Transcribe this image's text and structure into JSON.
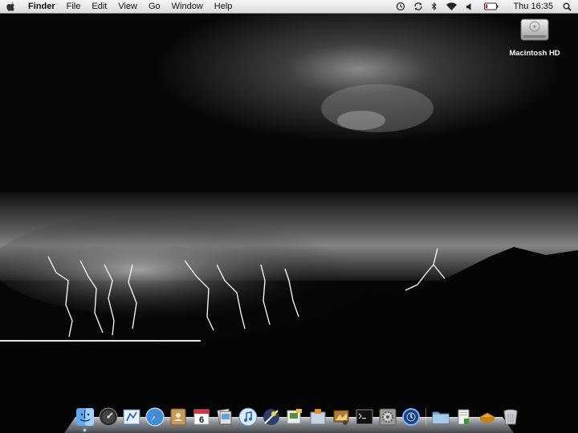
{
  "menubar": {
    "apple_icon": "apple-logo-icon",
    "app_name": "Finder",
    "menus": [
      "File",
      "Edit",
      "View",
      "Go",
      "Window",
      "Help"
    ],
    "status": {
      "icons": [
        "time-machine-icon",
        "sync-icon",
        "bluetooth-icon",
        "wifi-icon",
        "volume-icon",
        "battery-icon"
      ],
      "clock": "Thu 16:35",
      "search_icon": "spotlight-icon"
    }
  },
  "desktop": {
    "icons": [
      {
        "label": "Macintosh HD",
        "icon": "hard-drive-icon"
      }
    ]
  },
  "dock": {
    "apps": [
      {
        "icon": "finder-icon",
        "running": true
      },
      {
        "icon": "dashboard-icon",
        "running": false
      },
      {
        "icon": "mail-icon",
        "running": false
      },
      {
        "icon": "safari-icon",
        "running": false
      },
      {
        "icon": "address-book-icon",
        "running": false
      },
      {
        "icon": "ical-icon",
        "running": false,
        "badge": "6"
      },
      {
        "icon": "preview-icon",
        "running": false
      },
      {
        "icon": "itunes-icon",
        "running": false
      },
      {
        "icon": "iphoto-icon",
        "running": false
      },
      {
        "icon": "imovie-icon",
        "running": false
      },
      {
        "icon": "iweb-icon",
        "running": false
      },
      {
        "icon": "image-capture-icon",
        "running": false
      },
      {
        "icon": "terminal-icon",
        "running": false
      },
      {
        "icon": "system-preferences-icon",
        "running": false
      },
      {
        "icon": "time-machine-dock-icon",
        "running": false
      }
    ],
    "folders": [
      {
        "icon": "applications-folder-icon"
      },
      {
        "icon": "documents-stack-icon"
      },
      {
        "icon": "downloads-stack-icon"
      },
      {
        "icon": "trash-icon"
      }
    ]
  },
  "colors": {
    "menubar": "#e8e8e8",
    "sky": "#0a0a0a",
    "lightning": "#ffffff"
  }
}
